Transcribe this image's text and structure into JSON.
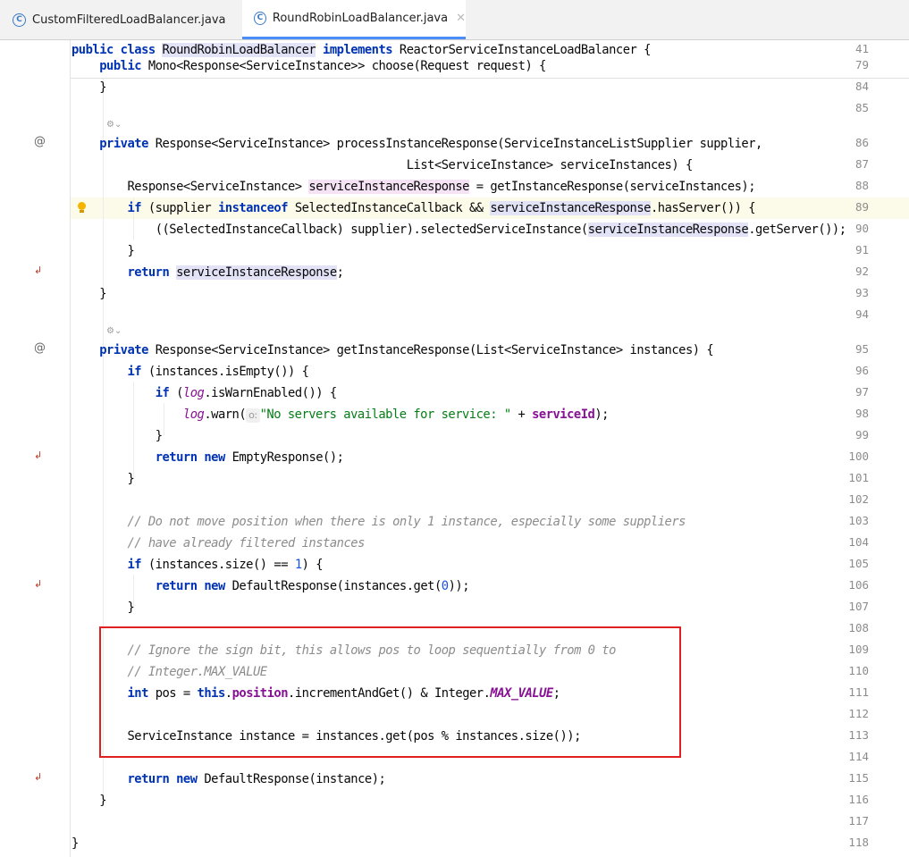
{
  "tabs": [
    {
      "label": "CustomFilteredLoadBalancer.java",
      "active": false
    },
    {
      "label": "RoundRobinLoadBalancer.java",
      "active": true
    }
  ],
  "icons": {
    "class_file": "c-icon",
    "close": "close-icon",
    "override": "override-icon",
    "return_marker": "return-icon",
    "intention": "lightbulb-icon",
    "code_lens": "code-lens-icon"
  },
  "colors": {
    "keyword": "#0033b3",
    "comment": "#8c8c8c",
    "string": "#067d17",
    "number": "#1750eb",
    "field": "#871094",
    "highlight_box": "#e02020"
  },
  "sticky": {
    "line41": {
      "num": "41",
      "kw1": "public class ",
      "cls": "RoundRobinLoadBalancer",
      "kw2": " implements ",
      "rest": "ReactorServiceInstanceLoadBalancer {"
    },
    "line79": {
      "num": "79",
      "kw": "public ",
      "rest": "Mono<Response<ServiceInstance>> choose(Request request) {"
    }
  },
  "gutter": {
    "nums": [
      "84",
      "85",
      "86",
      "87",
      "88",
      "89",
      "90",
      "91",
      "92",
      "93",
      "94",
      "95",
      "96",
      "97",
      "98",
      "99",
      "100",
      "101",
      "102",
      "103",
      "104",
      "105",
      "106",
      "107",
      "108",
      "109",
      "110",
      "111",
      "112",
      "113",
      "114",
      "115",
      "116",
      "117",
      "118"
    ]
  },
  "code": {
    "l84": "}",
    "l86": {
      "kw": "private ",
      "rest": "Response<ServiceInstance> processInstanceResponse(ServiceInstanceListSupplier supplier,"
    },
    "l87": "List<ServiceInstance> serviceInstances) {",
    "l88": {
      "a": "Response<ServiceInstance> ",
      "var": "serviceInstanceResponse",
      "b": " = getInstanceResponse(serviceInstances);"
    },
    "l89": {
      "kw1": "if ",
      "a": "(supplier ",
      "kw2": "instanceof ",
      "b": "SelectedInstanceCallback && ",
      "var1": "service",
      "var2": "InstanceResponse",
      "c": ".hasServer()) {"
    },
    "l90": {
      "a": "((SelectedInstanceCallback) supplier).selectedServiceInstance(",
      "var": "serviceInstanceResponse",
      "b": ".getServer());"
    },
    "l91": "}",
    "l92": {
      "kw": "return ",
      "var": "serviceInstanceResponse",
      "b": ";"
    },
    "l93": "}",
    "l95": {
      "kw": "private ",
      "rest": "Response<ServiceInstance> getInstanceResponse(List<ServiceInstance> instances) {"
    },
    "l96": {
      "kw": "if ",
      "rest": "(instances.isEmpty()) {"
    },
    "l97": {
      "kw": "if ",
      "a": "(",
      "log": "log",
      "b": ".isWarnEnabled()) {"
    },
    "l98": {
      "log": "log",
      "a": ".warn(",
      "hint": "o:",
      "str": "\"No servers available for service: \"",
      "b": " + ",
      "fld": "serviceId",
      "c": ");"
    },
    "l99": "}",
    "l100": {
      "kw1": "return ",
      "kw2": "new ",
      "rest": "EmptyResponse();"
    },
    "l101": "}",
    "l103": "// Do not move position when there is only 1 instance, especially some suppliers",
    "l104": "// have already filtered instances",
    "l105": {
      "kw": "if ",
      "a": "(instances.size() == ",
      "num": "1",
      "b": ") {"
    },
    "l106": {
      "kw1": "return ",
      "kw2": "new ",
      "a": "DefaultResponse(instances.get(",
      "num": "0",
      "b": "));"
    },
    "l107": "}",
    "l109": "// Ignore the sign bit, this allows pos to loop sequentially from 0 to",
    "l110": "// Integer.MAX_VALUE",
    "l111": {
      "kw1": "int ",
      "a": "pos = ",
      "kw2": "this",
      "b": ".",
      "fld": "position",
      "c": ".incrementAndGet() & Integer.",
      "sfld": "MAX_VALUE",
      "d": ";"
    },
    "l113": "ServiceInstance instance = instances.get(pos % instances.size());",
    "l115": {
      "kw1": "return ",
      "kw2": "new ",
      "rest": "DefaultResponse(instance);"
    },
    "l116": "}",
    "l118": "}"
  }
}
